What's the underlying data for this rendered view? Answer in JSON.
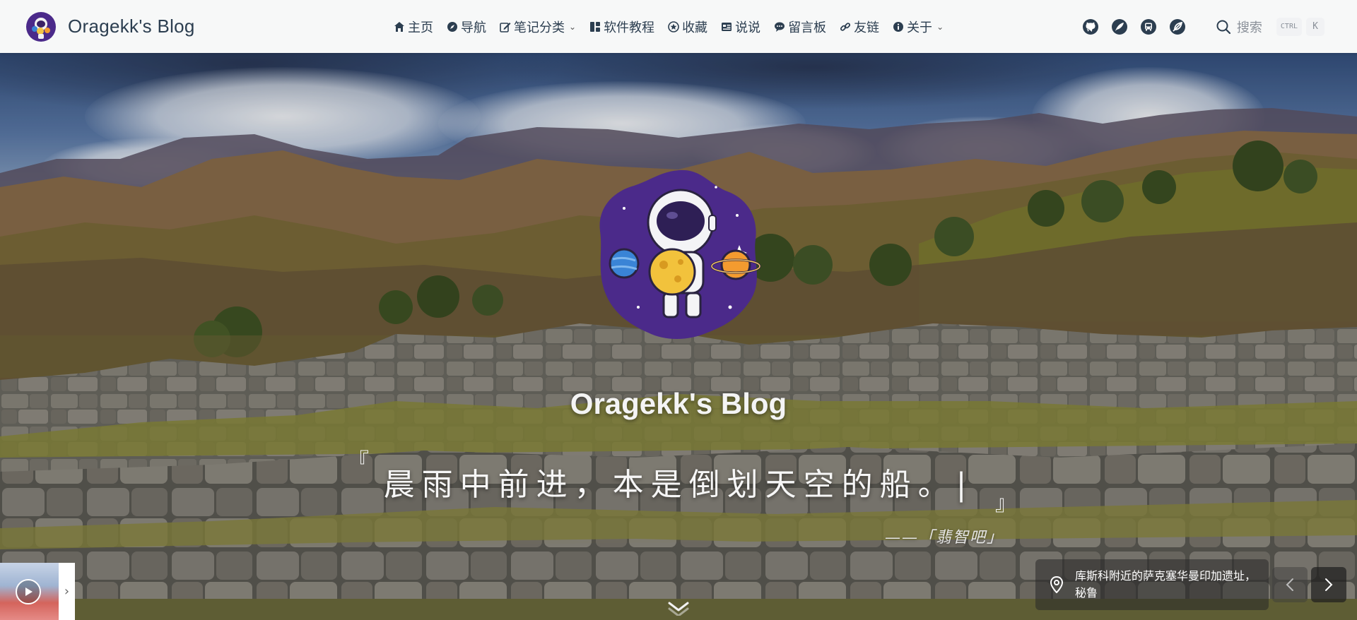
{
  "brand": {
    "title": "Oragekk's Blog",
    "logo_icon": "astronaut-avatar-icon"
  },
  "nav": {
    "items": [
      {
        "label": "主页",
        "icon": "home-icon",
        "dropdown": false
      },
      {
        "label": "导航",
        "icon": "compass-icon",
        "dropdown": false
      },
      {
        "label": "笔记分类",
        "icon": "edit-icon",
        "dropdown": true
      },
      {
        "label": "软件教程",
        "icon": "app-icon",
        "dropdown": false
      },
      {
        "label": "收藏",
        "icon": "star-icon",
        "dropdown": false
      },
      {
        "label": "说说",
        "icon": "talk-icon",
        "dropdown": false
      },
      {
        "label": "留言板",
        "icon": "comment-icon",
        "dropdown": false
      },
      {
        "label": "友链",
        "icon": "link-icon",
        "dropdown": false
      },
      {
        "label": "关于",
        "icon": "info-icon",
        "dropdown": true
      }
    ]
  },
  "social": [
    "github-icon",
    "feather-icon",
    "bus-icon",
    "leaf-icon"
  ],
  "search": {
    "label": "搜索",
    "kbd_ctrl": "CTRL",
    "kbd_key": "K"
  },
  "hero": {
    "site_title": "Oragekk's Blog",
    "quote_open": "『",
    "quote": "晨雨中前进，本是倒划天空的船。|",
    "quote_close": "』",
    "source": "——「翡智吧」"
  },
  "location": {
    "text": "库斯科附近的萨克塞华曼印加遗址，秘鲁"
  },
  "colors": {
    "nav_text": "#2c3e50",
    "accent_purple": "#4b2a8a",
    "hero_text": "#f4f4f4"
  }
}
